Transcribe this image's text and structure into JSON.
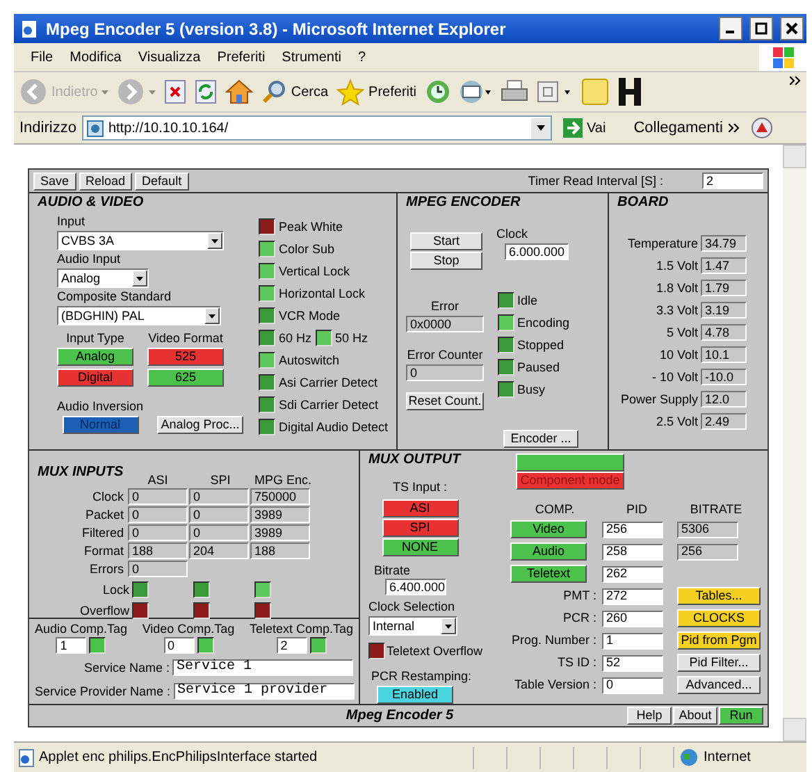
{
  "window": {
    "title": "Mpeg Encoder 5 (version 3.8) - Microsoft Internet Explorer"
  },
  "menu": [
    "File",
    "Modifica",
    "Visualizza",
    "Preferiti",
    "Strumenti",
    "?"
  ],
  "toolbar": [
    {
      "kind": "back",
      "label": "Indietro",
      "disabled": true
    },
    {
      "kind": "forward",
      "disabled": true
    },
    {
      "kind": "stop"
    },
    {
      "kind": "refresh"
    },
    {
      "kind": "home"
    },
    {
      "kind": "search",
      "label": "Cerca"
    },
    {
      "kind": "favorites",
      "label": "Preferiti"
    },
    {
      "kind": "history"
    },
    {
      "kind": "mail"
    },
    {
      "kind": "print"
    },
    {
      "kind": "edit"
    },
    {
      "kind": "notes"
    },
    {
      "kind": "h"
    }
  ],
  "address": {
    "label": "Indirizzo",
    "value": "http://10.10.10.164/",
    "go": "Vai",
    "links": "Collegamenti"
  },
  "applet": {
    "top_buttons": [
      "Save",
      "Reload",
      "Default"
    ],
    "timer": {
      "label": "Timer Read Interval [S] :",
      "value": "2"
    },
    "audio_video": {
      "title": "AUDIO & VIDEO",
      "input": {
        "label": "Input",
        "value": "CVBS 3A"
      },
      "audio_input": {
        "label": "Audio Input",
        "value": "Analog"
      },
      "composite_standard": {
        "label": "Composite Standard",
        "value": "(BDGHIN) PAL"
      },
      "input_type": {
        "label": "Input Type",
        "buttons": [
          {
            "label": "Analog",
            "color": "#4cc24c"
          },
          {
            "label": "Digital",
            "color": "#e83232"
          }
        ]
      },
      "video_format": {
        "label": "Video Format",
        "buttons": [
          {
            "label": "525",
            "color": "#e83232"
          },
          {
            "label": "625",
            "color": "#4cc24c"
          }
        ]
      },
      "audio_inversion": {
        "label": "Audio Inversion",
        "value": "Normal"
      },
      "analog_proc": "Analog Proc...",
      "indicators": [
        [
          {
            "label": "Peak White",
            "color": "#8c1c1c"
          }
        ],
        [
          {
            "label": "Color Sub",
            "color": "#5cc85c"
          }
        ],
        [
          {
            "label": "Vertical Lock",
            "color": "#5cc85c"
          }
        ],
        [
          {
            "label": "Horizontal Lock",
            "color": "#5cc85c"
          }
        ],
        [
          {
            "label": "VCR Mode",
            "color": "#3a9a3a"
          }
        ],
        [
          {
            "label": "60 Hz",
            "color": "#3a9a3a"
          },
          {
            "label": "50 Hz",
            "color": "#5cc85c"
          }
        ],
        [
          {
            "label": "Autoswitch",
            "color": "#5cc85c"
          }
        ],
        [
          {
            "label": "Asi Carrier Detect",
            "color": "#3a9a3a"
          }
        ],
        [
          {
            "label": "Sdi Carrier Detect",
            "color": "#3a9a3a"
          }
        ],
        [
          {
            "label": "Digital Audio Detect",
            "color": "#3a9a3a"
          }
        ]
      ]
    },
    "mpeg_encoder": {
      "title": "MPEG ENCODER",
      "start": "Start",
      "stop": "Stop",
      "clock": {
        "label": "Clock",
        "value": "6.000.000"
      },
      "error": {
        "label": "Error",
        "value": "0x0000"
      },
      "error_counter": {
        "label": "Error Counter",
        "value": "0"
      },
      "reset": "Reset Count.",
      "states": [
        {
          "label": "Idle",
          "color": "#3a9a3a"
        },
        {
          "label": "Encoding",
          "color": "#5cc85c"
        },
        {
          "label": "Stopped",
          "color": "#3a9a3a"
        },
        {
          "label": "Paused",
          "color": "#3a9a3a"
        },
        {
          "label": "Busy",
          "color": "#3a9a3a"
        }
      ],
      "encoder_button": "Encoder ..."
    },
    "board": {
      "title": "BOARD",
      "readings": [
        {
          "label": "Temperature",
          "value": "34.79"
        },
        {
          "label": "1.5 Volt",
          "value": "1.47"
        },
        {
          "label": "1.8 Volt",
          "value": "1.79"
        },
        {
          "label": "3.3 Volt",
          "value": "3.19"
        },
        {
          "label": "5 Volt",
          "value": "4.78"
        },
        {
          "label": "10 Volt",
          "value": "10.1"
        },
        {
          "label": "- 10 Volt",
          "value": "-10.0"
        },
        {
          "label": "Power Supply",
          "value": "12.0"
        },
        {
          "label": "2.5 Volt",
          "value": "2.49"
        }
      ]
    },
    "mux_inputs": {
      "title": "MUX INPUTS",
      "columns": [
        "ASI",
        "SPI",
        "MPG Enc."
      ],
      "rows": [
        {
          "label": "Clock",
          "values": [
            "0",
            "0",
            "750000"
          ]
        },
        {
          "label": "Packet",
          "values": [
            "0",
            "0",
            "3989"
          ]
        },
        {
          "label": "Filtered",
          "values": [
            "0",
            "0",
            "3989"
          ]
        },
        {
          "label": "Format",
          "values": [
            "188",
            "204",
            "188"
          ]
        },
        {
          "label": "Errors",
          "values": [
            "0"
          ]
        }
      ],
      "lock": {
        "label": "Lock",
        "lights": [
          {
            "color": "#3a9a3a"
          },
          {
            "color": "#3a9a3a"
          },
          {
            "color": "#5cc85c"
          }
        ]
      },
      "overflow": {
        "label": "Overflow",
        "lights": [
          {
            "color": "#8c1c1c"
          },
          {
            "color": "#8c1c1c"
          },
          {
            "color": "#8c1c1c"
          }
        ]
      }
    },
    "comp_tags": [
      {
        "label": "Audio Comp.Tag",
        "value": "1",
        "color": "#4cc24c"
      },
      {
        "label": "Video Comp.Tag",
        "value": "0",
        "color": "#4cc24c"
      },
      {
        "label": "Teletext Comp.Tag",
        "value": "2",
        "color": "#4cc24c"
      }
    ],
    "service_name": {
      "label": "Service Name :",
      "value": "Service 1"
    },
    "service_provider": {
      "label": "Service Provider Name :",
      "value": "Service 1 provider"
    },
    "mux_output": {
      "title": "MUX OUTPUT",
      "mode_buttons": [
        {
          "color": "#4cc24c"
        },
        {
          "label": "Component mode",
          "color": "#e83232"
        }
      ],
      "ts_input": {
        "label": "TS Input :",
        "buttons": [
          {
            "label": "ASI",
            "color": "#e83232"
          },
          {
            "label": "SPI",
            "color": "#e83232"
          },
          {
            "label": "NONE",
            "color": "#4cc24c"
          }
        ]
      },
      "bitrate": {
        "label": "Bitrate",
        "value": "6.400.000"
      },
      "clock_selection": {
        "label": "Clock Selection",
        "value": "Internal"
      },
      "teletext_overflow": {
        "label": "Teletext Overflow",
        "color": "#8c1c1c"
      },
      "pcr_restamping": {
        "label": "PCR Restamping:",
        "value": "Enabled"
      },
      "columns": [
        "COMP.",
        "PID",
        "BITRATE"
      ],
      "rows": [
        {
          "kind": "button",
          "label": "Video",
          "pid": "256",
          "bitrate": "5306"
        },
        {
          "kind": "button",
          "label": "Audio",
          "pid": "258",
          "bitrate": "256"
        },
        {
          "kind": "button",
          "label": "Teletext",
          "pid": "262"
        },
        {
          "kind": "text",
          "label": "PMT :",
          "pid": "272",
          "action": {
            "label": "Tables...",
            "color": "#f5d020"
          }
        },
        {
          "kind": "text",
          "label": "PCR :",
          "pid": "260",
          "action": {
            "label": "CLOCKS",
            "color": "#f5d020"
          }
        },
        {
          "kind": "text",
          "label": "Prog. Number :",
          "pid": "1",
          "action": {
            "label": "Pid from Pgm",
            "color": "#f5d020"
          }
        },
        {
          "kind": "text",
          "label": "TS ID :",
          "pid": "52",
          "action": {
            "label": "Pid Filter...",
            "color": "#e2e2e2"
          }
        },
        {
          "kind": "text",
          "label": "Table Version :",
          "pid": "0",
          "action": {
            "label": "Advanced...",
            "color": "#e2e2e2"
          }
        }
      ]
    },
    "footer": {
      "title": "Mpeg Encoder 5",
      "buttons": [
        {
          "label": "Help",
          "color": "#e2e2e2"
        },
        {
          "label": "About",
          "color": "#e2e2e2"
        },
        {
          "label": "Run",
          "color": "#4cc24c"
        }
      ]
    }
  },
  "status_bar": {
    "text": "Applet enc philips.EncPhilipsInterface started",
    "zone": "Internet"
  }
}
